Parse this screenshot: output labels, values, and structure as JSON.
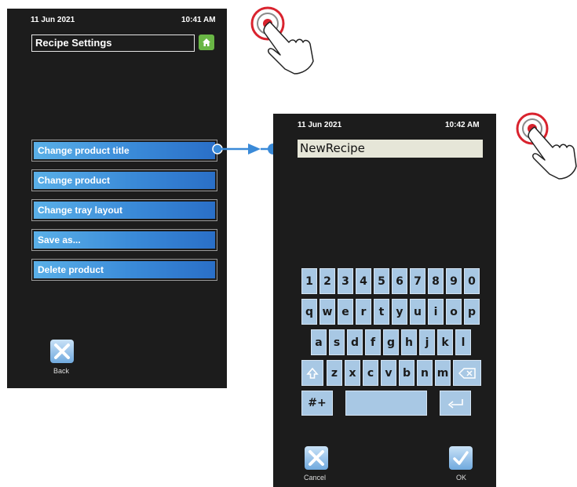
{
  "screen1": {
    "date": "11 Jun 2021",
    "time": "10:41 AM",
    "title": "Recipe Settings",
    "menu": [
      {
        "label": "Change product title"
      },
      {
        "label": "Change product"
      },
      {
        "label": "Change tray layout"
      },
      {
        "label": "Save as..."
      },
      {
        "label": "Delete product"
      }
    ],
    "back_label": "Back"
  },
  "screen2": {
    "date": "11 Jun 2021",
    "time": "10:42 AM",
    "input_value": "NewRecipe",
    "keyboard": {
      "row1": [
        "1",
        "2",
        "3",
        "4",
        "5",
        "6",
        "7",
        "8",
        "9",
        "0"
      ],
      "row2": [
        "q",
        "w",
        "e",
        "r",
        "t",
        "y",
        "u",
        "i",
        "o",
        "p"
      ],
      "row3": [
        "a",
        "s",
        "d",
        "f",
        "g",
        "h",
        "j",
        "k",
        "l"
      ],
      "row4": [
        "z",
        "x",
        "c",
        "v",
        "b",
        "n",
        "m"
      ],
      "symbols_label": "#+"
    },
    "cancel_label": "Cancel",
    "ok_label": "OK"
  },
  "colors": {
    "screen_bg": "#1c1c1c",
    "menu_blue": "#3a8ad8",
    "home_green": "#69b645",
    "key_blue": "#a8c8e4",
    "connector": "#3a8ad8",
    "touch_red": "#d9232e"
  },
  "icons": [
    "home-icon",
    "close-x-icon",
    "checkmark-icon",
    "shift-icon",
    "backspace-icon",
    "enter-icon",
    "touch-hand-icon"
  ]
}
